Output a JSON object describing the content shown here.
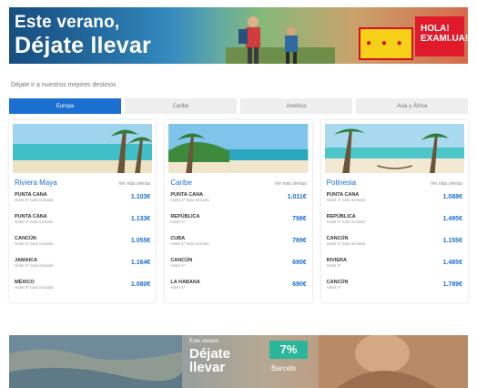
{
  "top_banner": {
    "line1": "Este verano,",
    "line2": "Déjate llevar",
    "brand_label": "",
    "promo_text": "HOLA!\nEXAMI.UA!"
  },
  "intro": "Déjate ir a nuestros mejores destinos",
  "tabs": [
    {
      "label": "Europa",
      "active": true
    },
    {
      "label": "Caribe",
      "active": false
    },
    {
      "label": "América",
      "active": false
    },
    {
      "label": "Asia y África",
      "active": false
    }
  ],
  "cards": [
    {
      "title": "Riviera Maya",
      "link": "Ver más ofertas",
      "offers": [
        {
          "name": "PUNTA CANA",
          "desc": "Hotel 5* todo incluido",
          "price": "1.103€"
        },
        {
          "name": "PUNTA CANA",
          "desc": "Hotel 4* todo incluido",
          "price": "1.133€"
        },
        {
          "name": "CANCÚN",
          "desc": "Hotel 4* todo incluido",
          "price": "1.055€"
        },
        {
          "name": "JAMAICA",
          "desc": "Hotel 4* todo incluido",
          "price": "1.164€"
        },
        {
          "name": "MÉXICO",
          "desc": "Hotel 5* todo incluido",
          "price": "1.080€"
        }
      ]
    },
    {
      "title": "Caribe",
      "link": "Ver más ofertas",
      "offers": [
        {
          "name": "PUNTA CANA",
          "desc": "Hotel 4* todo incluido",
          "price": "1.011€"
        },
        {
          "name": "REPÚBLICA",
          "desc": "Hotel 4*",
          "price": "798€"
        },
        {
          "name": "CUBA",
          "desc": "Hotel 4* todo incluido",
          "price": "789€"
        },
        {
          "name": "CANCÚN",
          "desc": "Hotel 4*",
          "price": "690€"
        },
        {
          "name": "LA HABANA",
          "desc": "Hotel 4*",
          "price": "690€"
        }
      ]
    },
    {
      "title": "Polinesia",
      "link": "Ver más ofertas",
      "offers": [
        {
          "name": "PUNTA CANA",
          "desc": "Hotel 4* todo incluido",
          "price": "1.088€"
        },
        {
          "name": "REPÚBLICA",
          "desc": "Hotel 4* todo incluido",
          "price": "1.495€"
        },
        {
          "name": "CANCÚN",
          "desc": "Hotel 4* todo incluido",
          "price": "1.155€"
        },
        {
          "name": "RIVIERA",
          "desc": "Hotel 4*",
          "price": "1.485€"
        },
        {
          "name": "CANCÚN",
          "desc": "Hotel 4*",
          "price": "1.789€"
        }
      ]
    }
  ],
  "bottom_banner": {
    "line1": "Este verano",
    "line2": "Déjate",
    "line3": "llevar",
    "percent": "7%",
    "sub": "Barcelo"
  },
  "colors": {
    "accent": "#1b6fd0",
    "promo_red": "#e01a2a",
    "brand_yellow": "#f7d117",
    "teal": "#2bb59a"
  }
}
